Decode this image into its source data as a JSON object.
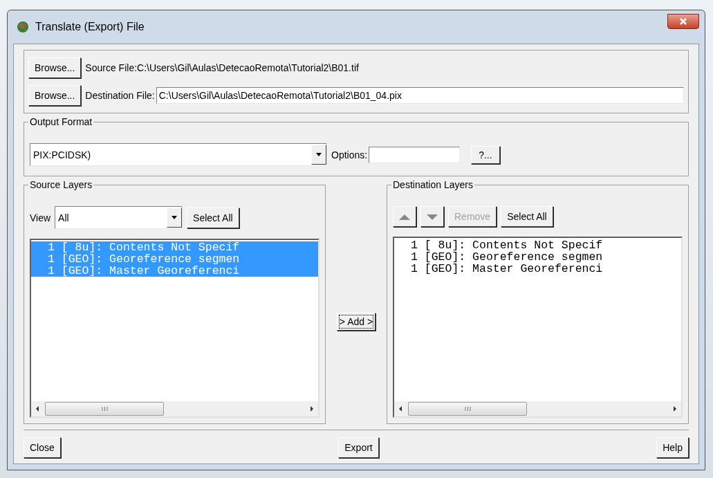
{
  "window": {
    "title": "Translate (Export) File"
  },
  "source_file": {
    "button": "Browse...",
    "label": "Source File:",
    "value": "C:\\Users\\Gil\\Aulas\\DetecaoRemota\\Tutorial2\\B01.tif"
  },
  "destination_file": {
    "button": "Browse...",
    "label": "Destination File:",
    "value": "C:\\Users\\Gil\\Aulas\\DetecaoRemota\\Tutorial2\\B01_04.pix"
  },
  "output_format": {
    "title": "Output Format",
    "format": "PIX:PCIDSK)",
    "options_label": "Options:",
    "help_button": "?..."
  },
  "source_layers": {
    "title": "Source Layers",
    "view_label": "View",
    "view_value": "All",
    "select_all": "Select All",
    "items": [
      {
        "text": "1 [ 8u]: Contents Not Specif",
        "selected": true
      },
      {
        "text": "1 [GEO]: Georeference segmen",
        "selected": true
      },
      {
        "text": "1 [GEO]: Master Georeferenci",
        "selected": true
      }
    ]
  },
  "add_button": "> Add >",
  "destination_layers": {
    "title": "Destination Layers",
    "remove": {
      "label": "Remove",
      "disabled": true
    },
    "select_all": "Select All",
    "items": [
      {
        "text": "1 [ 8u]: Contents Not Specif",
        "selected": false
      },
      {
        "text": "1 [GEO]: Georeference segmen",
        "selected": false
      },
      {
        "text": "1 [GEO]: Master Georeferenci",
        "selected": false
      }
    ]
  },
  "buttons": {
    "close": "Close",
    "export": "Export",
    "help": "Help"
  }
}
